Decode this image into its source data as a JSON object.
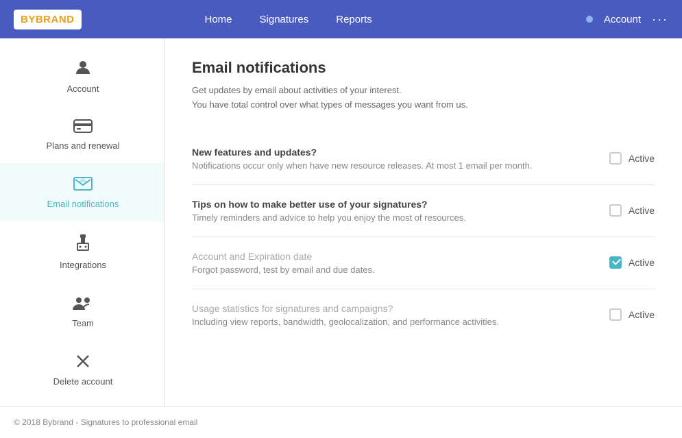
{
  "header": {
    "logo_brand": "BY",
    "logo_brand2": "BRAND",
    "nav": [
      {
        "label": "Home",
        "href": "#"
      },
      {
        "label": "Signatures",
        "href": "#"
      },
      {
        "label": "Reports",
        "href": "#"
      }
    ],
    "account_label": "Account",
    "more_label": "···"
  },
  "sidebar": {
    "items": [
      {
        "id": "account",
        "label": "Account",
        "icon": "👤"
      },
      {
        "id": "plans",
        "label": "Plans and renewal",
        "icon": "💳"
      },
      {
        "id": "email-notifications",
        "label": "Email notifications",
        "icon": "✉",
        "active": true
      },
      {
        "id": "integrations",
        "label": "Integrations",
        "icon": "🔌"
      },
      {
        "id": "team",
        "label": "Team",
        "icon": "👥"
      },
      {
        "id": "delete-account",
        "label": "Delete account",
        "icon": "✕"
      }
    ]
  },
  "content": {
    "title": "Email notifications",
    "description_line1": "Get updates by email about activities of your interest.",
    "description_line2": "You have total control over what types of messages you want from us.",
    "notifications": [
      {
        "id": "new-features",
        "title": "New features and updates?",
        "description": "Notifications occur only when have new resource releases. At most 1 email per month.",
        "active_label": "Active",
        "checked": false,
        "muted": false
      },
      {
        "id": "tips",
        "title": "Tips on how to make better use of your signatures?",
        "description": "Timely reminders and advice to help you enjoy the most of resources.",
        "active_label": "Active",
        "checked": false,
        "muted": false
      },
      {
        "id": "account-expiration",
        "title": "Account and Expiration date",
        "description": "Forgot password, test by email and due dates.",
        "active_label": "Active",
        "checked": true,
        "muted": true
      },
      {
        "id": "usage-stats",
        "title": "Usage statistics for signatures and campaigns?",
        "description": "Including view reports, bandwidth, geolocalization, and performance activities.",
        "active_label": "Active",
        "checked": false,
        "muted": true
      }
    ]
  },
  "footer": {
    "text": "© 2018 Bybrand - Signatures to professional email"
  }
}
